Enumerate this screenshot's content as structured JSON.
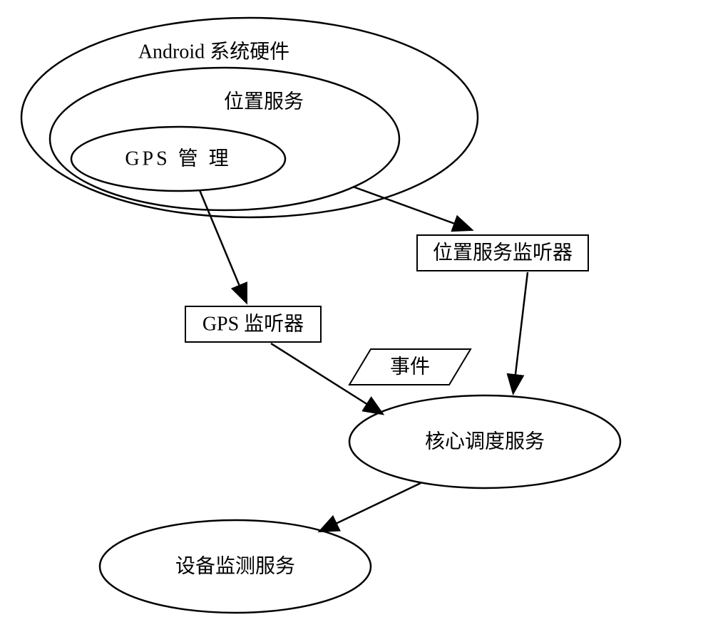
{
  "nodes": {
    "outer_ellipse": "Android 系统硬件",
    "middle_ellipse": "位置服务",
    "inner_ellipse": "GPS  管 理",
    "location_listener": "位置服务监听器",
    "gps_listener": "GPS 监听器",
    "event": "事件",
    "core_service": "核心调度服务",
    "monitor_service": "设备监测服务"
  }
}
